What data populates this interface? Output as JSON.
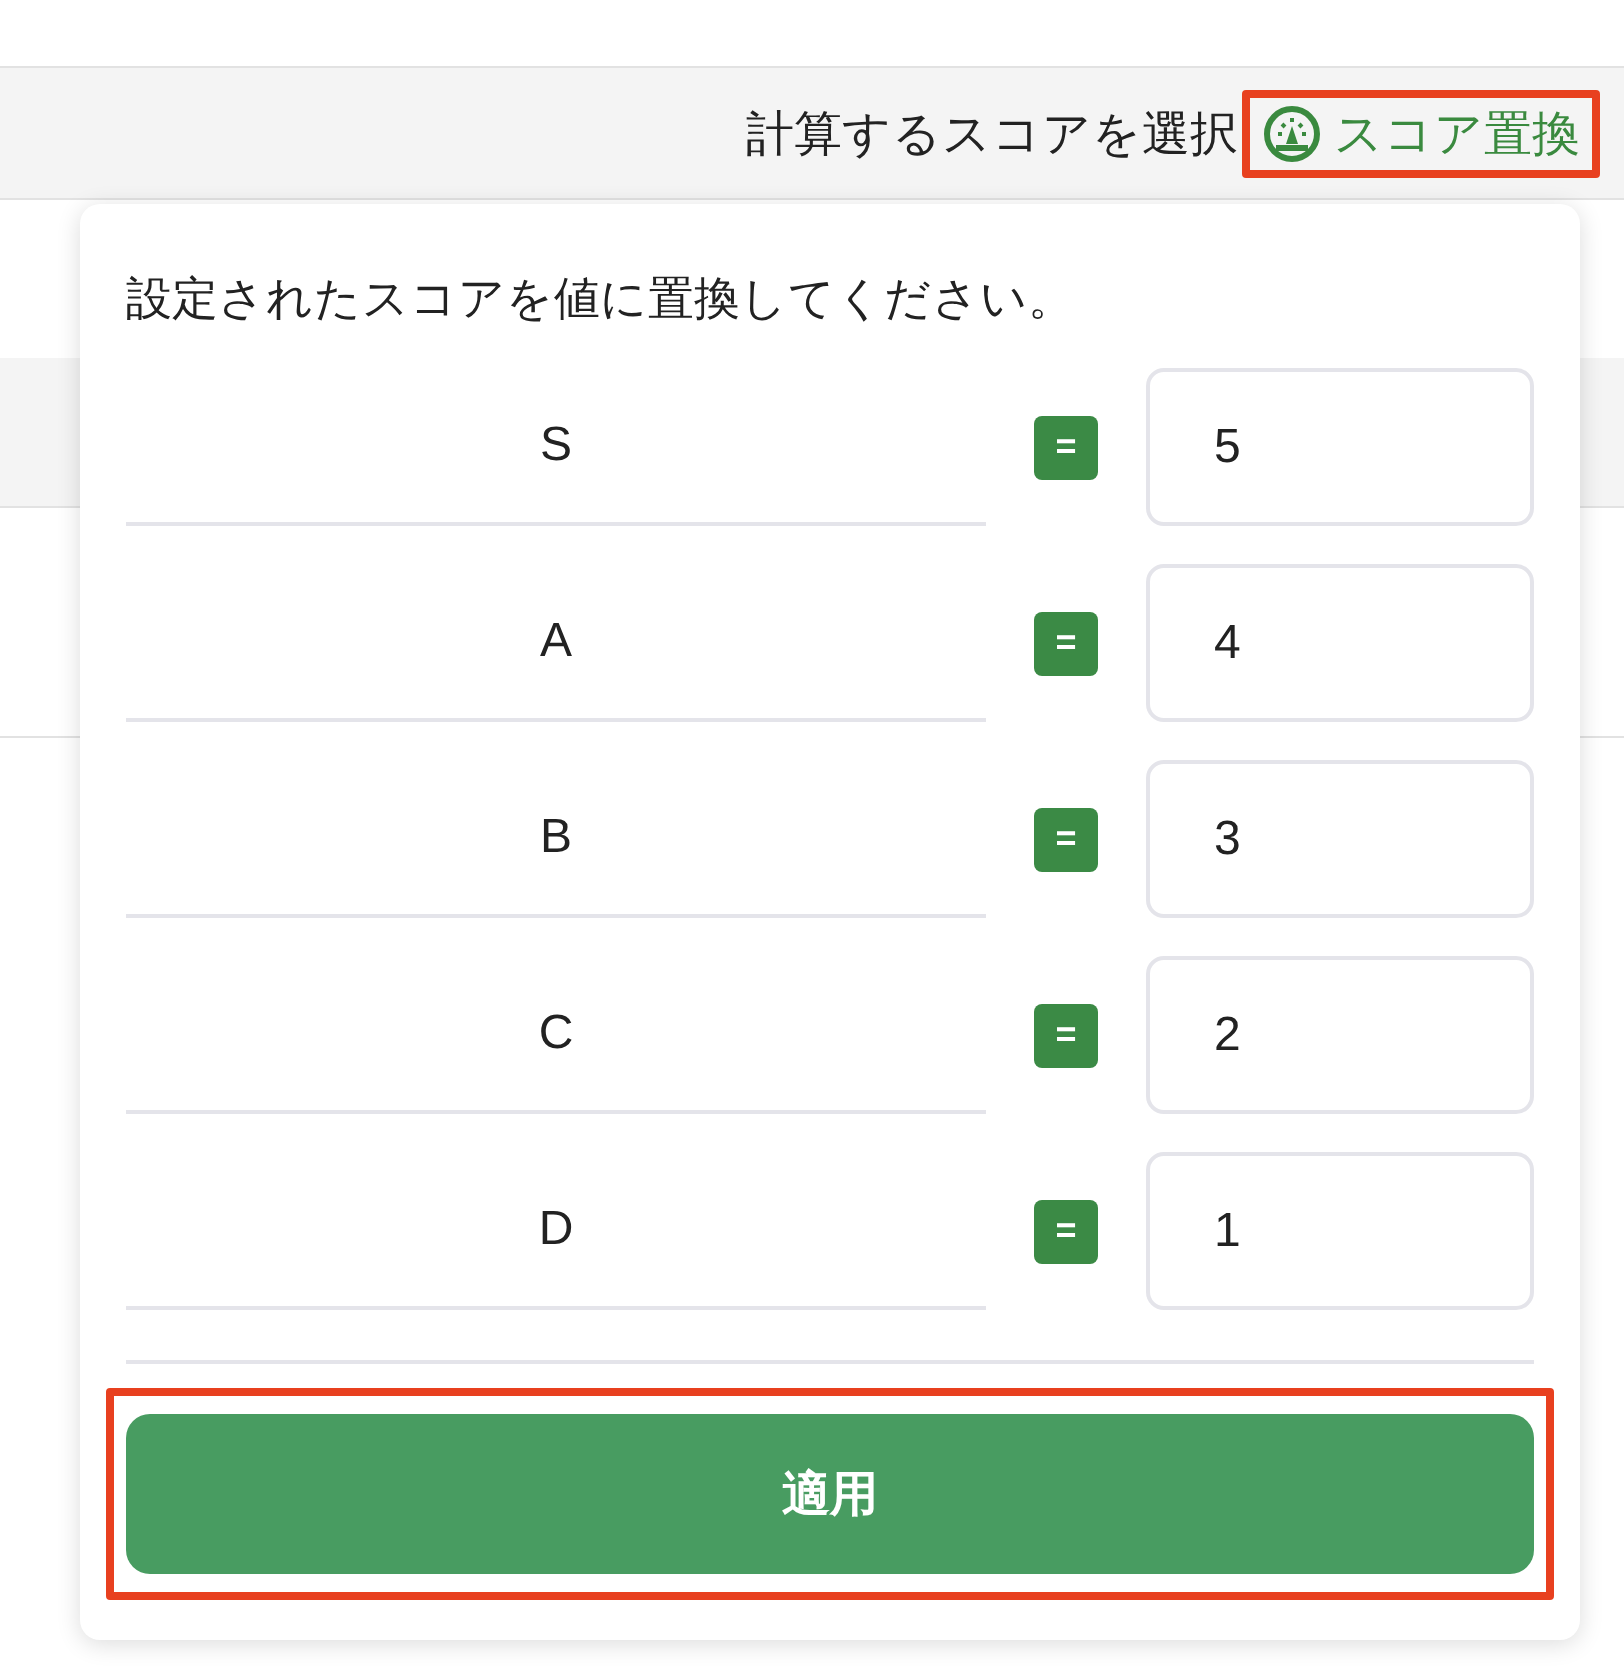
{
  "toolbar": {
    "label": "計算するスコアを選択",
    "score_link": {
      "label": "スコア置換",
      "highlighted": true
    }
  },
  "popover": {
    "instruction": "設定されたスコアを値に置換してください。",
    "rows": [
      {
        "grade": "S",
        "operator": "=",
        "value": "5"
      },
      {
        "grade": "A",
        "operator": "=",
        "value": "4"
      },
      {
        "grade": "B",
        "operator": "=",
        "value": "3"
      },
      {
        "grade": "C",
        "operator": "=",
        "value": "2"
      },
      {
        "grade": "D",
        "operator": "=",
        "value": "1"
      }
    ],
    "apply_button": {
      "label": "適用",
      "highlighted": true
    }
  }
}
